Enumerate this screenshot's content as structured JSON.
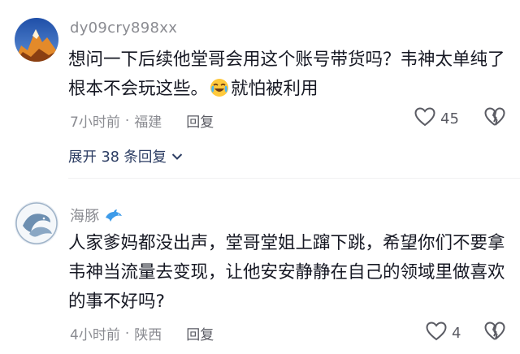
{
  "comments": [
    {
      "username": "dy09cry898xx",
      "text_before_emoji": "想问一下后续他堂哥会用这个账号带货吗？韦神太单纯了根本不会玩这些。",
      "emoji": "crying-laughing-face",
      "text_after_emoji": "就怕被利用",
      "time": "7小时前",
      "location": "福建",
      "reply_label": "回复",
      "like_count": "45",
      "expand_label": "展开 38 条回复"
    },
    {
      "username": "海豚",
      "badge": "dolphin-icon",
      "text": "人家爹妈都没出声，堂哥堂姐上蹿下跳，希望你们不要拿韦神当流量去变现，让他安安静静在自己的领域里做喜欢的事不好吗?",
      "time": "4小时前",
      "location": "陕西",
      "reply_label": "回复",
      "like_count": "4"
    }
  ],
  "colors": {
    "username": "#8a8b91",
    "body_text": "#161823",
    "expand_link": "#2c3d63",
    "meta": "#8a8b91"
  }
}
